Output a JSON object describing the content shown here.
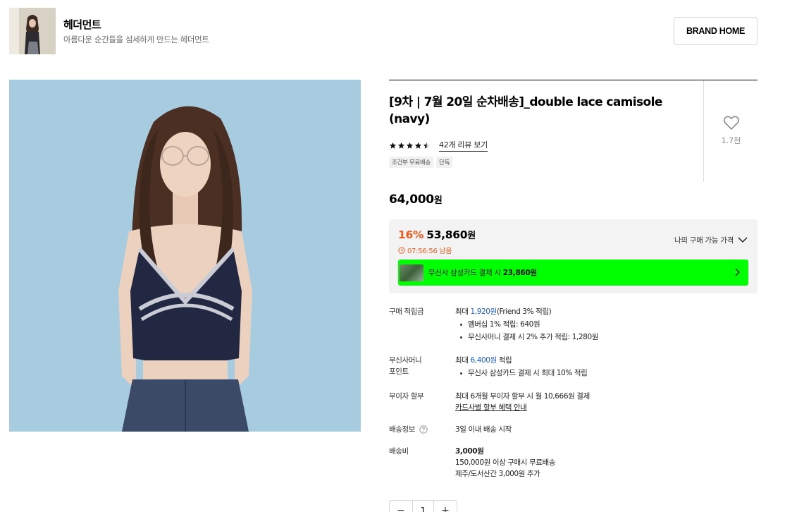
{
  "brand": {
    "name": "헤더먼트",
    "description": "아름다운 순간들을 섬세하게 만드는 헤더먼트",
    "home_button": "BRAND HOME"
  },
  "product": {
    "title": "[9차 | 7월 20일 순차배송]_double lace camisole (navy)",
    "rating": 4.5,
    "review_link": "42개 리뷰 보기",
    "like_count": "1.7천",
    "tags": [
      "조건부 무료배송",
      "단독"
    ],
    "original_price": "64,000",
    "currency": "원"
  },
  "sale": {
    "discount_rate": "16%",
    "price": "53,860",
    "currency": "원",
    "timer": "07:56:56 남음",
    "my_price_label": "나의 구매 가능 가격",
    "card_banner_text": "무신사 삼성카드 결제 시",
    "card_banner_price": "23,860원"
  },
  "info": {
    "points": {
      "label": "구매 적립금",
      "prefix": "최대",
      "amount": "1,920원",
      "suffix": "(Friend 3% 적립)",
      "bullets": [
        "멤버십 1% 적립: 640원",
        "무신사머니 결제 시 2% 추가 적립: 1,280원"
      ]
    },
    "money": {
      "label_line1": "무신사머니",
      "label_line2": "포인트",
      "prefix": "최대",
      "amount": "6,400원",
      "suffix": "적립",
      "bullets": [
        "무신사 삼성카드 결제 시 최대 10% 적립"
      ]
    },
    "installment": {
      "label": "무이자 할부",
      "text": "최대 6개월 무이자 할부 시 월 10,666원 결제",
      "link": "카드사별 할부 혜택 안내"
    },
    "shipping": {
      "label": "배송정보",
      "value": "3일 이내 배송 시작"
    },
    "shipping_fee": {
      "label": "배송비",
      "amount": "3,000원",
      "line2": "150,000원 이상 구매시 무료배송",
      "line3": "제주/도서산간 3,000원 추가"
    }
  },
  "quantity": {
    "minus": "−",
    "value": "1",
    "plus": "+"
  },
  "colors": {
    "accent_orange": "#f05a1f",
    "accent_blue": "#1b5fd1",
    "banner_green": "#00ff00",
    "background_sky": "#a7cce0",
    "top_navy": "#232a45"
  },
  "icons": [
    "heart-icon",
    "star-icon",
    "clock-icon",
    "chevron-down-icon",
    "chevron-right-icon",
    "question-circle-icon"
  ]
}
